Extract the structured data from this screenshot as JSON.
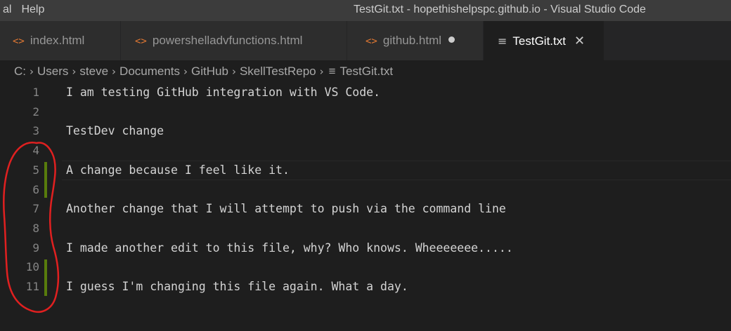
{
  "menu": {
    "items": [
      "al",
      "Help"
    ]
  },
  "window": {
    "title": "TestGit.txt - hopethishelpspc.github.io - Visual Studio Code"
  },
  "tabs": [
    {
      "label": "index.html",
      "icon": "code-icon",
      "glyph": "<>"
    },
    {
      "label": "powershelladvfunctions.html",
      "icon": "code-icon",
      "glyph": "<>"
    },
    {
      "label": "github.html",
      "icon": "code-icon",
      "glyph": "<>",
      "modified": true
    },
    {
      "label": "TestGit.txt",
      "icon": "text-file-icon",
      "glyph": "≡",
      "active": true
    }
  ],
  "breadcrumb": {
    "items": [
      "C:",
      "Users",
      "steve",
      "Documents",
      "GitHub",
      "SkellTestRepo",
      "TestGit.txt"
    ],
    "separator": "›",
    "file_glyph": "≡"
  },
  "editor": {
    "lines": [
      {
        "n": "1",
        "text": "I am testing GitHub integration with VS Code."
      },
      {
        "n": "2",
        "text": ""
      },
      {
        "n": "3",
        "text": "TestDev change"
      },
      {
        "n": "4",
        "text": ""
      },
      {
        "n": "5",
        "text": "A change because I feel like it."
      },
      {
        "n": "6",
        "text": ""
      },
      {
        "n": "7",
        "text": "Another change that I will attempt to push via the command line"
      },
      {
        "n": "8",
        "text": ""
      },
      {
        "n": "9",
        "text": "I made another edit to this file, why? Who knows. Wheeeeeee....."
      },
      {
        "n": "10",
        "text": ""
      },
      {
        "n": "11",
        "text": "I guess I'm changing this file again. What a day."
      }
    ]
  },
  "colors": {
    "git_added": "#587c0c",
    "annotation": "#e02020",
    "html_icon": "#e37933"
  }
}
